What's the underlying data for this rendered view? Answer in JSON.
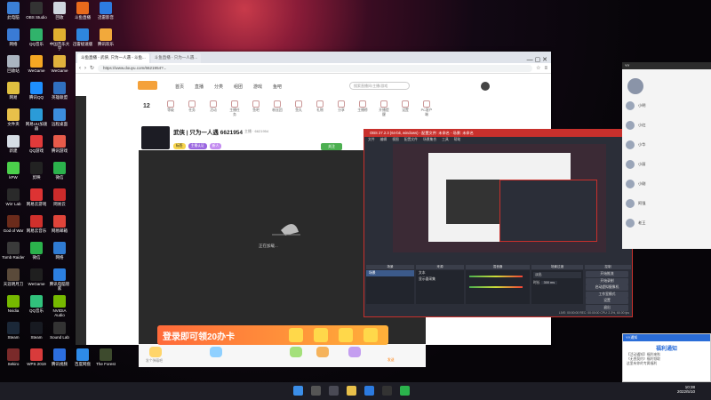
{
  "desktop_icons": [
    {
      "label": "此电脑",
      "color": "#3b7fd6",
      "col": 0,
      "row": 0
    },
    {
      "label": "OBS Studio",
      "color": "#333333",
      "col": 1,
      "row": 0
    },
    {
      "label": "回收",
      "color": "#cfd6de",
      "col": 2,
      "row": 0
    },
    {
      "label": "斗鱼直播",
      "color": "#e86a1c",
      "col": 3,
      "row": 0
    },
    {
      "label": "迅雷影音",
      "color": "#2d7be0",
      "col": 4,
      "row": 0
    },
    {
      "label": "网络",
      "color": "#3a7bd5",
      "col": 0,
      "row": 1
    },
    {
      "label": "QQ音乐",
      "color": "#30b36b",
      "col": 1,
      "row": 1
    },
    {
      "label": "中国音乐大学",
      "color": "#e0b030",
      "col": 2,
      "row": 1
    },
    {
      "label": "迅雷极速版",
      "color": "#2e86de",
      "col": 3,
      "row": 1
    },
    {
      "label": "腾讯欢乐",
      "color": "#f2a93b",
      "col": 4,
      "row": 1
    },
    {
      "label": "回收站",
      "color": "#aab4c0",
      "col": 0,
      "row": 2
    },
    {
      "label": "WeGame",
      "color": "#f5a623",
      "col": 1,
      "row": 2
    },
    {
      "label": "WeGame",
      "color": "#e2b13c",
      "col": 2,
      "row": 2
    },
    {
      "label": "网易",
      "color": "#e0c040",
      "col": 0,
      "row": 3
    },
    {
      "label": "腾讯QQ",
      "color": "#1e8fff",
      "col": 1,
      "row": 3
    },
    {
      "label": "英雄联盟",
      "color": "#3070c0",
      "col": 2,
      "row": 3
    },
    {
      "label": "文件夹",
      "color": "#e8c04a",
      "col": 0,
      "row": 4
    },
    {
      "label": "网易UU加速器",
      "color": "#2b9bd8",
      "col": 1,
      "row": 4
    },
    {
      "label": "远程桌面",
      "color": "#3c8dde",
      "col": 2,
      "row": 4
    },
    {
      "label": "新建",
      "color": "#d6dde5",
      "col": 0,
      "row": 5
    },
    {
      "label": "QQ游戏",
      "color": "#e23a3a",
      "col": 1,
      "row": 5
    },
    {
      "label": "腾讯游戏",
      "color": "#e85a4a",
      "col": 2,
      "row": 5
    },
    {
      "label": "kPW",
      "color": "#4bd04b",
      "col": 0,
      "row": 6
    },
    {
      "label": "剪映",
      "color": "#222222",
      "col": 1,
      "row": 6
    },
    {
      "label": "微信",
      "color": "#2bb24c",
      "col": 2,
      "row": 6
    },
    {
      "label": "Wirr Lab",
      "color": "#2a2a2a",
      "col": 0,
      "row": 7
    },
    {
      "label": "网易云游戏",
      "color": "#d33",
      "col": 1,
      "row": 7
    },
    {
      "label": "网易云",
      "color": "#cc2b2b",
      "col": 2,
      "row": 7
    },
    {
      "label": "God of War",
      "color": "#6b2b1b",
      "col": 0,
      "row": 8
    },
    {
      "label": "网易云音乐",
      "color": "#d0302c",
      "col": 1,
      "row": 8
    },
    {
      "label": "网易邮箱",
      "color": "#e0443a",
      "col": 2,
      "row": 8
    },
    {
      "label": "Tomb Raider",
      "color": "#3a3a3a",
      "col": 0,
      "row": 9
    },
    {
      "label": "微信",
      "color": "#2bb24c",
      "col": 1,
      "row": 9
    },
    {
      "label": "网络",
      "color": "#2f7bd3",
      "col": 2,
      "row": 9
    },
    {
      "label": "天涯明月刀",
      "color": "#5a4a3a",
      "col": 0,
      "row": 10
    },
    {
      "label": "WeGame",
      "color": "#1f1f1f",
      "col": 1,
      "row": 10
    },
    {
      "label": "腾讯电脑管家",
      "color": "#2c7fe0",
      "col": 2,
      "row": 10
    },
    {
      "label": "Nvidia",
      "color": "#76b900",
      "col": 0,
      "row": 11
    },
    {
      "label": "QQ音乐",
      "color": "#31c27c",
      "col": 1,
      "row": 11
    },
    {
      "label": "NVIDIA Audio",
      "color": "#76b900",
      "col": 2,
      "row": 11
    },
    {
      "label": "Steam",
      "color": "#1b2838",
      "col": 0,
      "row": 12
    },
    {
      "label": "Steam",
      "color": "#171a21",
      "col": 1,
      "row": 12
    },
    {
      "label": "Sound Lab",
      "color": "#333",
      "col": 2,
      "row": 12
    },
    {
      "label": "Sekiro",
      "color": "#7a2a2a",
      "col": 0,
      "row": 13
    },
    {
      "label": "WPS 2019",
      "color": "#d83b3b",
      "col": 1,
      "row": 13
    },
    {
      "label": "腾讯视频",
      "color": "#2c6fe0",
      "col": 2,
      "row": 13
    },
    {
      "label": "百度网盘",
      "color": "#2e8be8",
      "col": 3,
      "row": 13
    },
    {
      "label": "The Forest",
      "color": "#3d4a2d",
      "col": 4,
      "row": 13
    }
  ],
  "browser": {
    "tabs": [
      "斗鱼直播 - 武侠, 只为一人遇 - 斗鱼...",
      "斗鱼直播 - 只为一人遇..."
    ],
    "url": "https://www.douyu.com/6621954?...",
    "search_placeholder": "搜索直播间/主播/游戏",
    "site_nav": [
      "首页",
      "直播",
      "分类",
      "组团",
      "游戏",
      "鱼吧"
    ],
    "categories": [
      "等级",
      "任务",
      "活动",
      "主播任务",
      "鱼吧",
      "粉丝团",
      "鱼丸",
      "礼物",
      "分享",
      "主播榜",
      "开播提醒",
      "设置",
      "PC客户端"
    ],
    "room_title": "武侠 | 只为一人遇 6621954",
    "room_meta": "主播 · 6621954",
    "room_tags": [
      "标签",
      "主播认证",
      "新人"
    ],
    "follow_button": "关注",
    "player_status": "正在加载...",
    "gift_label": "礼物",
    "danmaku_placeholder": "发个弹幕吧",
    "send_label": "发送",
    "banner_text": "登录即可领20办卡",
    "level_number": "12"
  },
  "obs": {
    "title": "OBS 27.2.3 (64-bit, windows) - 配置文件: 未命名 - 场景: 未命名",
    "menu": [
      "文件",
      "编辑",
      "视图",
      "配置文件",
      "场景集合",
      "工具",
      "帮助"
    ],
    "panels": [
      "场景",
      "来源",
      "混音器",
      "场景过渡",
      "控制"
    ],
    "scene_item": "场景",
    "source_items": [
      "文本",
      "显示器采集"
    ],
    "controls": [
      "开始推流",
      "开始录制",
      "启动虚拟摄像机",
      "工作室模式",
      "设置",
      "退出"
    ],
    "transition_label": "淡出",
    "duration_label": "时长",
    "duration_value": "300 ms",
    "status_text": "LIVE: 00:00:00  REC: 00:00:00  CPU: 2.3%, 60.00 fps"
  },
  "chat": {
    "header": "YY",
    "items": [
      "小明",
      "小红",
      "小华",
      "小丽",
      "小刚",
      "阿强",
      "老王"
    ]
  },
  "notification": {
    "header": "YY通知",
    "title": "福利通知",
    "body_lines": [
      "【活动通知】福利来啦",
      "《无畏契约》福利领取",
      "这里有你的专属福利"
    ]
  },
  "taskbar": {
    "time": "10:38",
    "date": "2022/5/10"
  }
}
